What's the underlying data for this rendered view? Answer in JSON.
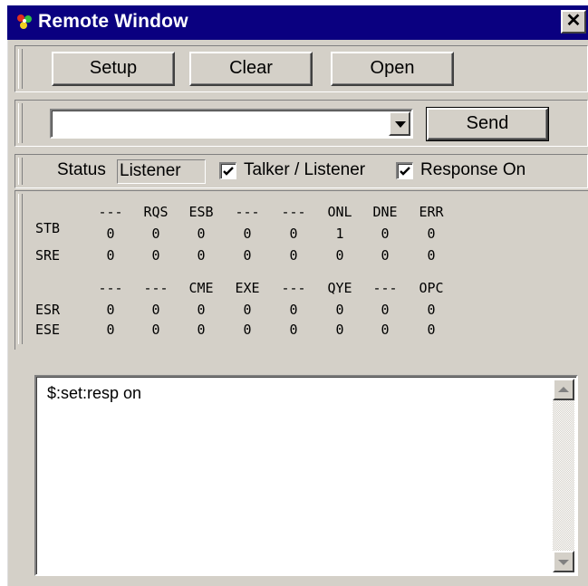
{
  "window": {
    "title": "Remote Window",
    "close_label": "✕"
  },
  "toolbar": {
    "setup_label": "Setup",
    "clear_label": "Clear",
    "open_label": "Open"
  },
  "command": {
    "value": "",
    "send_label": "Send"
  },
  "status": {
    "label": "Status",
    "value": "Listener",
    "talker_listener": {
      "label": "Talker / Listener",
      "checked": true
    },
    "response_on": {
      "label": "Response On",
      "checked": true
    }
  },
  "registers": {
    "group1_headers": [
      "---",
      "RQS",
      "ESB",
      "---",
      "---",
      "ONL",
      "DNE",
      "ERR"
    ],
    "group1_rows": [
      {
        "name": "STB",
        "values": [
          "0",
          "0",
          "0",
          "0",
          "0",
          "1",
          "0",
          "0"
        ]
      },
      {
        "name": "SRE",
        "values": [
          "0",
          "0",
          "0",
          "0",
          "0",
          "0",
          "0",
          "0"
        ]
      }
    ],
    "group2_headers": [
      "---",
      "---",
      "CME",
      "EXE",
      "---",
      "QYE",
      "---",
      "OPC"
    ],
    "group2_rows": [
      {
        "name": "ESR",
        "values": [
          "0",
          "0",
          "0",
          "0",
          "0",
          "0",
          "0",
          "0"
        ]
      },
      {
        "name": "ESE",
        "values": [
          "0",
          "0",
          "0",
          "0",
          "0",
          "0",
          "0",
          "0"
        ]
      }
    ]
  },
  "log": {
    "text": "$:set:resp on"
  },
  "colors": {
    "titlebar": "#0a0080",
    "face": "#d4d0c8"
  }
}
